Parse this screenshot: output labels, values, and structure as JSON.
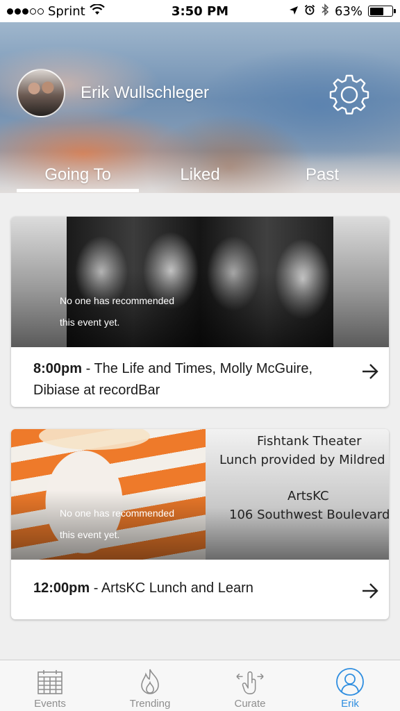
{
  "status_bar": {
    "carrier": "Sprint",
    "time": "3:50 PM",
    "battery_percent": "63%",
    "battery_level": 0.63,
    "signal_bars_filled": 3,
    "signal_bars_total": 5
  },
  "profile": {
    "name": "Erik Wullschleger"
  },
  "tabs": [
    {
      "label": "Going To",
      "selected": true
    },
    {
      "label": "Liked",
      "selected": false
    },
    {
      "label": "Past",
      "selected": false
    }
  ],
  "events": [
    {
      "time": "8:00pm",
      "separator": " - ",
      "title": "The Life and Times, Molly McGuire, Dibiase at recordBar",
      "recommendation_line1": "No one has recommended",
      "recommendation_line2": "this event yet."
    },
    {
      "time": "12:00pm",
      "separator": " - ",
      "title": "ArtsKC Lunch and Learn",
      "recommendation_line1": "No one has recommended",
      "recommendation_line2": "this event yet.",
      "image_text": {
        "line1": "Fishtank Theater",
        "line2": "Lunch provided by Mildred",
        "line3": "ArtsKC",
        "line4": "106 Southwest Boulevard"
      }
    }
  ],
  "tab_bar": [
    {
      "label": "Events",
      "icon": "calendar-icon",
      "active": false
    },
    {
      "label": "Trending",
      "icon": "flame-icon",
      "active": false
    },
    {
      "label": "Curate",
      "icon": "swipe-hand-icon",
      "active": false
    },
    {
      "label": "Erik",
      "icon": "user-icon",
      "active": true
    }
  ],
  "colors": {
    "accent": "#2f8ee0",
    "inactive_tab": "#8e8e8e",
    "background": "#efefef"
  }
}
